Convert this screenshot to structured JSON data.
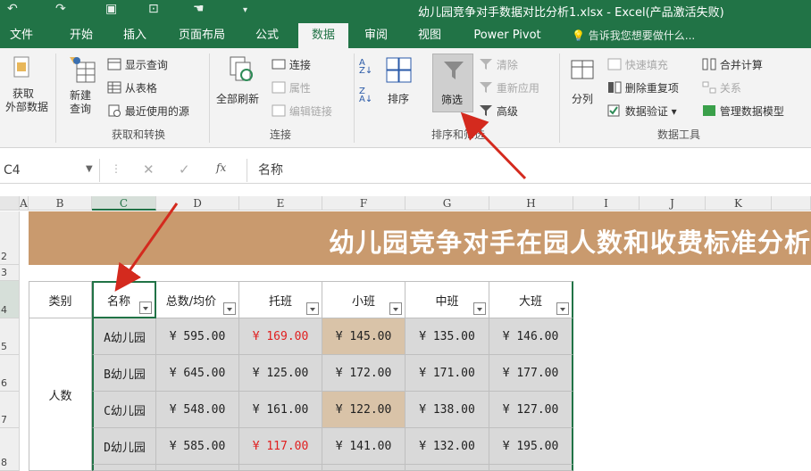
{
  "titlebar": {
    "doc_title": "幼儿园竞争对手数据对比分析1.xlsx - Excel(产品激活失败)"
  },
  "menu": {
    "tabs": [
      "文件",
      "开始",
      "插入",
      "页面布局",
      "公式",
      "数据",
      "审阅",
      "视图",
      "Power Pivot"
    ],
    "active_tab": "数据",
    "tell_me": "告诉我您想要做什么..."
  },
  "ribbon": {
    "get_external_data": [
      "获取",
      "外部数据"
    ],
    "new_query": [
      "新建",
      "查询"
    ],
    "show_queries": "显示查询",
    "from_table": "从表格",
    "recent_sources": "最近使用的源",
    "group_get_transform": "获取和转换",
    "refresh_all": "全部刷新",
    "connections": "连接",
    "properties": "属性",
    "edit_links": "编辑链接",
    "group_connections": "连接",
    "sort": "排序",
    "filter": "筛选",
    "clear": "清除",
    "reapply": "重新应用",
    "advanced": "高级",
    "group_sort_filter": "排序和筛选",
    "text_to_columns": "分列",
    "flash_fill": "快速填充",
    "remove_duplicates": "删除重复项",
    "data_validation": "数据验证",
    "consolidate": "合并计算",
    "relationships": "关系",
    "manage_data_model": "管理数据模型",
    "group_data_tools": "数据工具"
  },
  "formula_bar": {
    "name_box": "C4",
    "content": "名称"
  },
  "grid": {
    "columns": [
      "A",
      "B",
      "C",
      "D",
      "E",
      "F",
      "G",
      "H",
      "I",
      "J",
      "K"
    ],
    "rows": [
      "2",
      "3",
      "4",
      "5",
      "6",
      "7",
      "8"
    ],
    "banner_title": "幼儿园竞争对手在园人数和收费标准分析",
    "category_header": "类别",
    "category_value": "人数",
    "headers": [
      "名称",
      "总数/均价",
      "托班",
      "小班",
      "中班",
      "大班"
    ],
    "data_rows": [
      {
        "name": "A幼儿园",
        "total": "¥ 595.00",
        "tuo": "¥ 169.00",
        "xiao": "¥ 145.00",
        "zhong": "¥ 135.00",
        "da": "¥ 146.00"
      },
      {
        "name": "B幼儿园",
        "total": "¥ 645.00",
        "tuo": "¥ 125.00",
        "xiao": "¥ 172.00",
        "zhong": "¥ 171.00",
        "da": "¥ 177.00"
      },
      {
        "name": "C幼儿园",
        "total": "¥ 548.00",
        "tuo": "¥ 161.00",
        "xiao": "¥ 122.00",
        "zhong": "¥ 138.00",
        "da": "¥ 127.00"
      },
      {
        "name": "D幼儿园",
        "total": "¥ 585.00",
        "tuo": "¥ 117.00",
        "xiao": "¥ 141.00",
        "zhong": "¥ 132.00",
        "da": "¥ 195.00"
      }
    ]
  },
  "colors": {
    "excel_green": "#217346",
    "banner": "#c99a6e",
    "data_gray": "#d9d9d9",
    "data_beige": "#d9c3a8",
    "highlight_red": "#e02020",
    "arrow_red": "#d42a1e"
  }
}
